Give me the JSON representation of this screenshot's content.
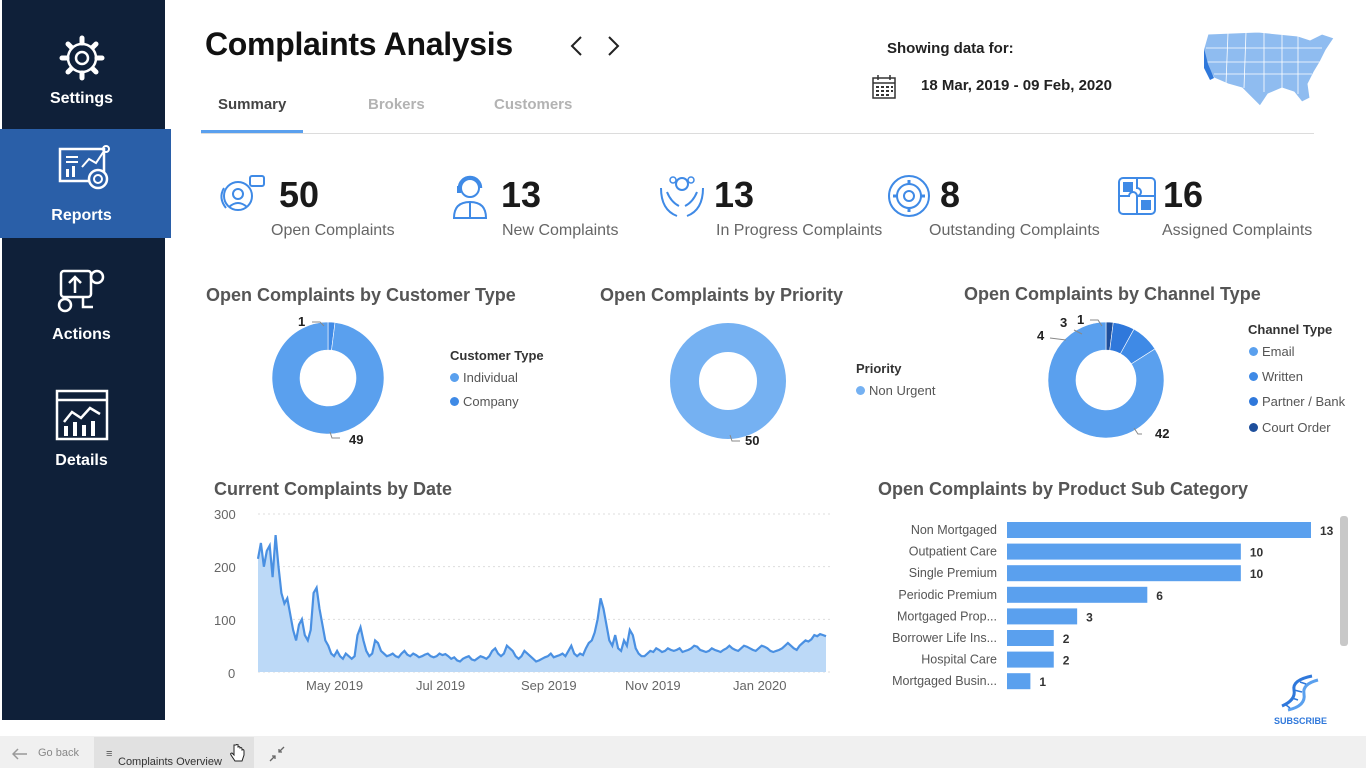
{
  "sidebar": {
    "items": [
      {
        "label": "Settings",
        "icon": "gear-icon"
      },
      {
        "label": "Reports",
        "icon": "report-icon",
        "active": true
      },
      {
        "label": "Actions",
        "icon": "actions-icon"
      },
      {
        "label": "Details",
        "icon": "details-icon"
      }
    ]
  },
  "header": {
    "title": "Complaints Analysis",
    "tabs": [
      {
        "label": "Summary",
        "active": true
      },
      {
        "label": "Brokers"
      },
      {
        "label": "Customers"
      }
    ],
    "showing_label": "Showing data for:",
    "date_range": "18 Mar, 2019 - 09 Feb, 2020"
  },
  "kpis": [
    {
      "value": "50",
      "label": "Open Complaints"
    },
    {
      "value": "13",
      "label": "New Complaints"
    },
    {
      "value": "13",
      "label": "In Progress Complaints"
    },
    {
      "value": "8",
      "label": "Outstanding Complaints"
    },
    {
      "value": "16",
      "label": "Assigned Complaints"
    }
  ],
  "colors": {
    "accent": "#5aa0ee",
    "sidebar": "#0f2039",
    "sidebar_active": "#2a5fa8",
    "email": "#5aa0ee",
    "written": "#3f8ae6",
    "partner": "#2f78db",
    "court": "#1e4f9c",
    "area_fill": "#bcd9f7",
    "line": "#4a90e2"
  },
  "customer_type": {
    "title": "Open Complaints by Customer Type",
    "legend_title": "Customer Type",
    "legend": [
      "Individual",
      "Company"
    ],
    "labels": [
      "1",
      "49"
    ]
  },
  "priority": {
    "title": "Open Complaints by Priority",
    "legend_title": "Priority",
    "legend": [
      "Non Urgent"
    ],
    "labels": [
      "50"
    ]
  },
  "channel": {
    "title": "Open Complaints by Channel Type",
    "legend_title": "Channel Type",
    "legend": [
      "Email",
      "Written",
      "Partner / Bank",
      "Court Order"
    ],
    "labels": [
      "3",
      "1",
      "4",
      "42"
    ]
  },
  "date_chart": {
    "title": "Current Complaints by Date",
    "y_ticks": [
      "300",
      "200",
      "100",
      "0"
    ],
    "x_ticks": [
      "May 2019",
      "Jul 2019",
      "Sep 2019",
      "Nov 2019",
      "Jan 2020"
    ]
  },
  "product_chart": {
    "title": "Open Complaints by Product Sub Category"
  },
  "footer": {
    "go_back": "Go back",
    "page_tab": "Complaints Overview"
  },
  "subscribe_label": "SUBSCRIBE",
  "chart_data": [
    {
      "type": "pie",
      "title": "Open Complaints by Customer Type",
      "categories": [
        "Individual",
        "Company"
      ],
      "values": [
        49,
        1
      ]
    },
    {
      "type": "pie",
      "title": "Open Complaints by Priority",
      "categories": [
        "Non Urgent"
      ],
      "values": [
        50
      ]
    },
    {
      "type": "pie",
      "title": "Open Complaints by Channel Type",
      "categories": [
        "Email",
        "Written",
        "Partner / Bank",
        "Court Order"
      ],
      "values": [
        42,
        4,
        3,
        1
      ]
    },
    {
      "type": "area",
      "title": "Current Complaints by Date",
      "ylim": [
        0,
        300
      ],
      "x_start": "2019-03-18",
      "x_end": "2020-02-09",
      "values": [
        215,
        245,
        200,
        230,
        240,
        180,
        260,
        200,
        150,
        130,
        140,
        110,
        80,
        60,
        90,
        100,
        70,
        60,
        80,
        150,
        160,
        120,
        90,
        60,
        50,
        35,
        30,
        40,
        30,
        25,
        35,
        30,
        25,
        30,
        70,
        85,
        60,
        40,
        30,
        35,
        60,
        55,
        40,
        35,
        30,
        32,
        35,
        30,
        28,
        35,
        40,
        33,
        30,
        35,
        32,
        28,
        30,
        33,
        35,
        30,
        28,
        30,
        35,
        32,
        34,
        30,
        25,
        28,
        22,
        20,
        25,
        28,
        30,
        24,
        22,
        26,
        30,
        28,
        25,
        30,
        40,
        45,
        35,
        30,
        35,
        50,
        45,
        40,
        30,
        25,
        30,
        40,
        35,
        30,
        25,
        20,
        22,
        25,
        28,
        30,
        35,
        28,
        30,
        32,
        35,
        30,
        40,
        50,
        35,
        30,
        35,
        32,
        45,
        55,
        60,
        75,
        100,
        140,
        120,
        90,
        60,
        50,
        70,
        45,
        40,
        60,
        50,
        80,
        70,
        45,
        35,
        30,
        30,
        35,
        40,
        38,
        45,
        42,
        38,
        40,
        45,
        42,
        40,
        42,
        45,
        38,
        40,
        42,
        45,
        50,
        48,
        42,
        40,
        38,
        40,
        45,
        42,
        40,
        38,
        42,
        45,
        50,
        45,
        42,
        40,
        45,
        50,
        48,
        45,
        42,
        40,
        45,
        50,
        48,
        45,
        40,
        38,
        40,
        42,
        45,
        50,
        55,
        50,
        45,
        42,
        50,
        55,
        60,
        58,
        62,
        70,
        68,
        72,
        70,
        68
      ]
    },
    {
      "type": "bar",
      "title": "Open Complaints by Product Sub Category",
      "categories": [
        "Non Mortgaged",
        "Outpatient Care",
        "Single Premium",
        "Periodic Premium",
        "Mortgaged Prop...",
        "Borrower Life Ins...",
        "Hospital Care",
        "Mortgaged Busin..."
      ],
      "values": [
        13,
        10,
        10,
        6,
        3,
        2,
        2,
        1
      ]
    }
  ]
}
